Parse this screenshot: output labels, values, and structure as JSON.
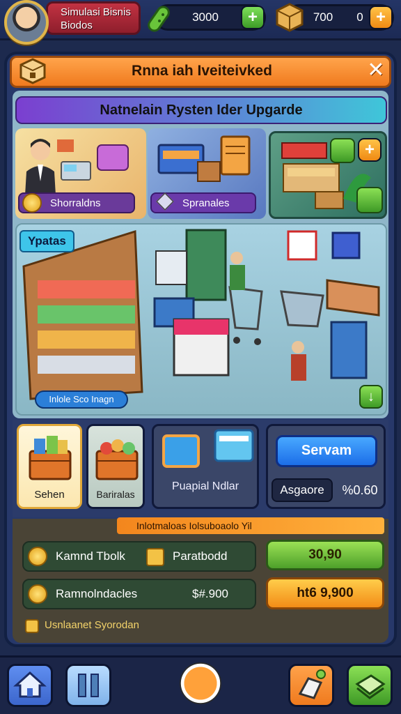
{
  "player": {
    "name_line1": "Simulasi Bisnis",
    "name_line2": "Biodos"
  },
  "resources": [
    {
      "icon": "cucumber-icon",
      "value": "3000"
    },
    {
      "icon": "crate-icon",
      "value": "700",
      "extra": "0"
    }
  ],
  "panel": {
    "title": "Rnna iah Iveiteivked",
    "subtitle": "Natnelain Rysten Ider Upgarde",
    "cards_top": [
      {
        "label": "Shorraldns"
      },
      {
        "label": "Spranales"
      }
    ],
    "store_tag": "Ypatas",
    "store_footer": "Inlole Sco Inagn"
  },
  "items": [
    {
      "label": "Sehen"
    },
    {
      "label": "Bariralas"
    },
    {
      "label": "Puapial Ndlar"
    }
  ],
  "actions": {
    "server_button": "Servam",
    "assignee_label": "Asgaore",
    "assignee_value": "%0.60"
  },
  "info": {
    "strip_text": "Inlotmaloas Iolsuboaolo Yil",
    "rows": [
      {
        "label": "Kamnd Tbolk",
        "mid": "Paratbodd"
      },
      {
        "label": "Ramnolndacles",
        "mid": "$#.900"
      }
    ],
    "value_green": "30,90",
    "value_orange": "ht6 9,900",
    "footer": "Usnlaanet Syorodan"
  },
  "colors": {
    "accent_orange": "#f07a1e",
    "accent_green": "#4da02a",
    "accent_blue": "#1c6ee8"
  }
}
